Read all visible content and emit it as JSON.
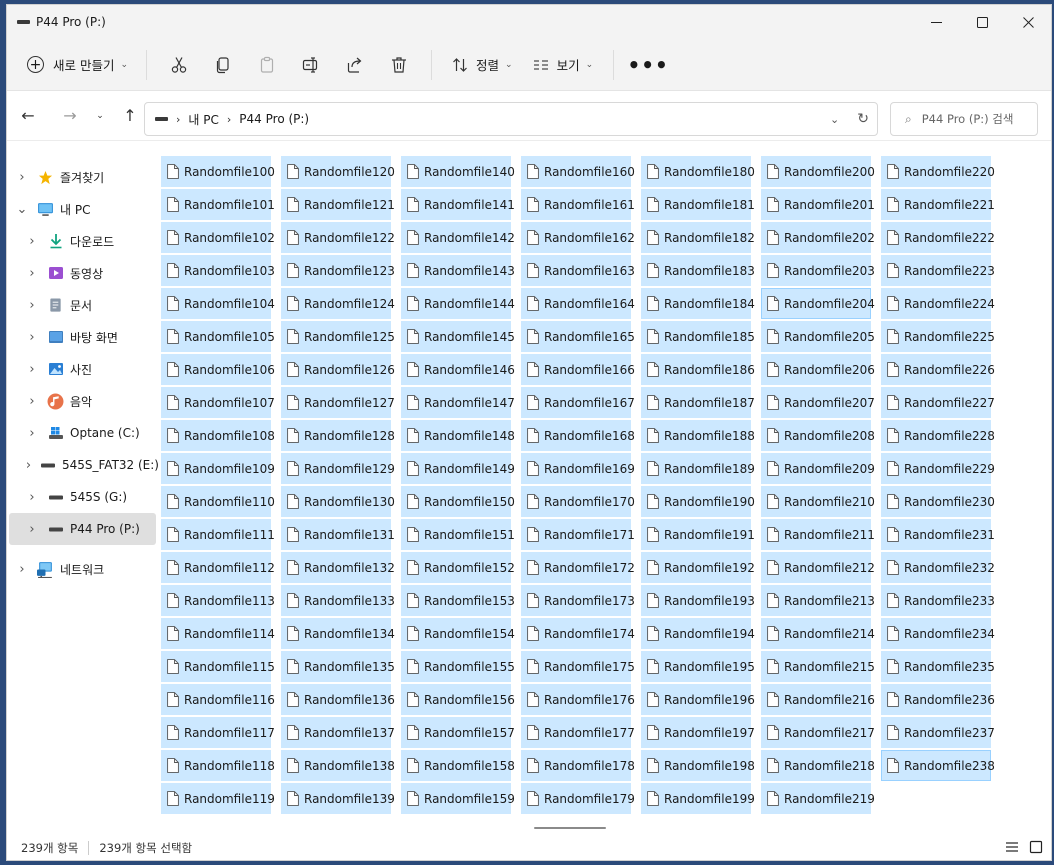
{
  "window": {
    "title": "P44 Pro (P:)",
    "controls": [
      "minimize",
      "maximize",
      "close"
    ]
  },
  "toolbar": {
    "new_label": "새로 만들기",
    "sort_label": "정렬",
    "view_label": "보기",
    "icons": [
      "cut-icon",
      "copy-icon",
      "paste-icon",
      "rename-icon",
      "share-icon",
      "delete-icon"
    ],
    "more": "•••"
  },
  "address": {
    "crumbs": [
      "내 PC",
      "P44 Pro (P:)"
    ],
    "search_placeholder": "P44 Pro (P:) 검색"
  },
  "sidebar": {
    "items": [
      {
        "label": "즐겨찾기",
        "icon": "star-icon",
        "expander": ">",
        "level": 0
      },
      {
        "label": "내 PC",
        "icon": "pc-icon",
        "expander": "v",
        "level": 0
      },
      {
        "label": "다운로드",
        "icon": "download-icon",
        "expander": ">",
        "level": 1
      },
      {
        "label": "동영상",
        "icon": "video-icon",
        "expander": ">",
        "level": 1
      },
      {
        "label": "문서",
        "icon": "document-icon",
        "expander": ">",
        "level": 1
      },
      {
        "label": "바탕 화면",
        "icon": "desktop-icon",
        "expander": ">",
        "level": 1
      },
      {
        "label": "사진",
        "icon": "picture-icon",
        "expander": ">",
        "level": 1
      },
      {
        "label": "음악",
        "icon": "music-icon",
        "expander": ">",
        "level": 1
      },
      {
        "label": "Optane (C:)",
        "icon": "os-drive-icon",
        "expander": ">",
        "level": 1
      },
      {
        "label": "545S_FAT32 (E:)",
        "icon": "drive-icon",
        "expander": ">",
        "level": 1
      },
      {
        "label": "545S (G:)",
        "icon": "drive-icon",
        "expander": ">",
        "level": 1
      },
      {
        "label": "P44 Pro (P:)",
        "icon": "drive-icon",
        "expander": ">",
        "level": 1,
        "selected": true
      },
      {
        "label": "네트워크",
        "icon": "network-icon",
        "expander": ">",
        "level": 0
      }
    ]
  },
  "files": {
    "prefix": "Randomfile",
    "first": 100,
    "last": 238,
    "rows_per_column": 20,
    "focused": [
      "Randomfile204",
      "Randomfile238"
    ],
    "selection_color": "#cce8ff"
  },
  "status": {
    "count": "239개 항목",
    "selected": "239개 항목 선택함"
  },
  "colors": {
    "accent": "#0067c0",
    "selection": "#cce8ff",
    "chrome": "#f3f3f3"
  }
}
